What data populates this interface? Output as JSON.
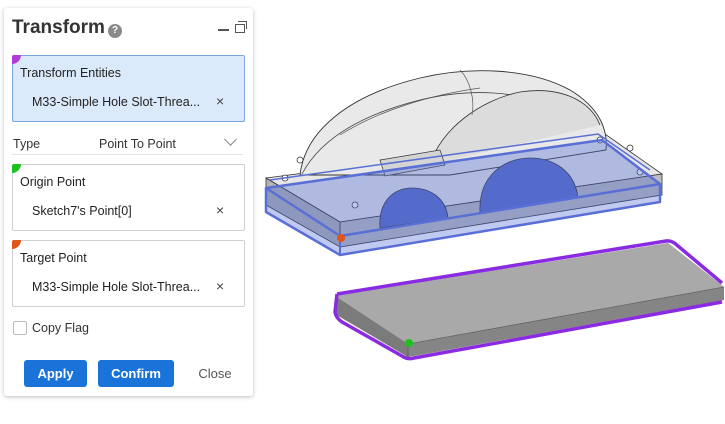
{
  "panel": {
    "title": "Transform",
    "help_icon": "?",
    "transform_entities": {
      "label": "Transform Entities",
      "value": "M33-Simple Hole Slot-Threa...",
      "remove": "×",
      "marker_color": "#b03bd6"
    },
    "type": {
      "label": "Type",
      "value": "Point To Point"
    },
    "origin_point": {
      "label": "Origin Point",
      "value": "Sketch7's Point[0]",
      "remove": "×",
      "marker_color": "#1cc21c"
    },
    "target_point": {
      "label": "Target Point",
      "value": "M33-Simple Hole Slot-Threa...",
      "remove": "×",
      "marker_color": "#e0561a"
    },
    "copy_flag": {
      "label": "Copy Flag",
      "checked": false
    },
    "buttons": {
      "apply": "Apply",
      "confirm": "Confirm",
      "close": "Close"
    }
  },
  "colors": {
    "accent": "#1a73d9",
    "selection_highlight": "#5a6fd6",
    "plate_outline": "#8a2be2",
    "origin_marker": "#1cc21c",
    "target_marker": "#e0561a"
  }
}
